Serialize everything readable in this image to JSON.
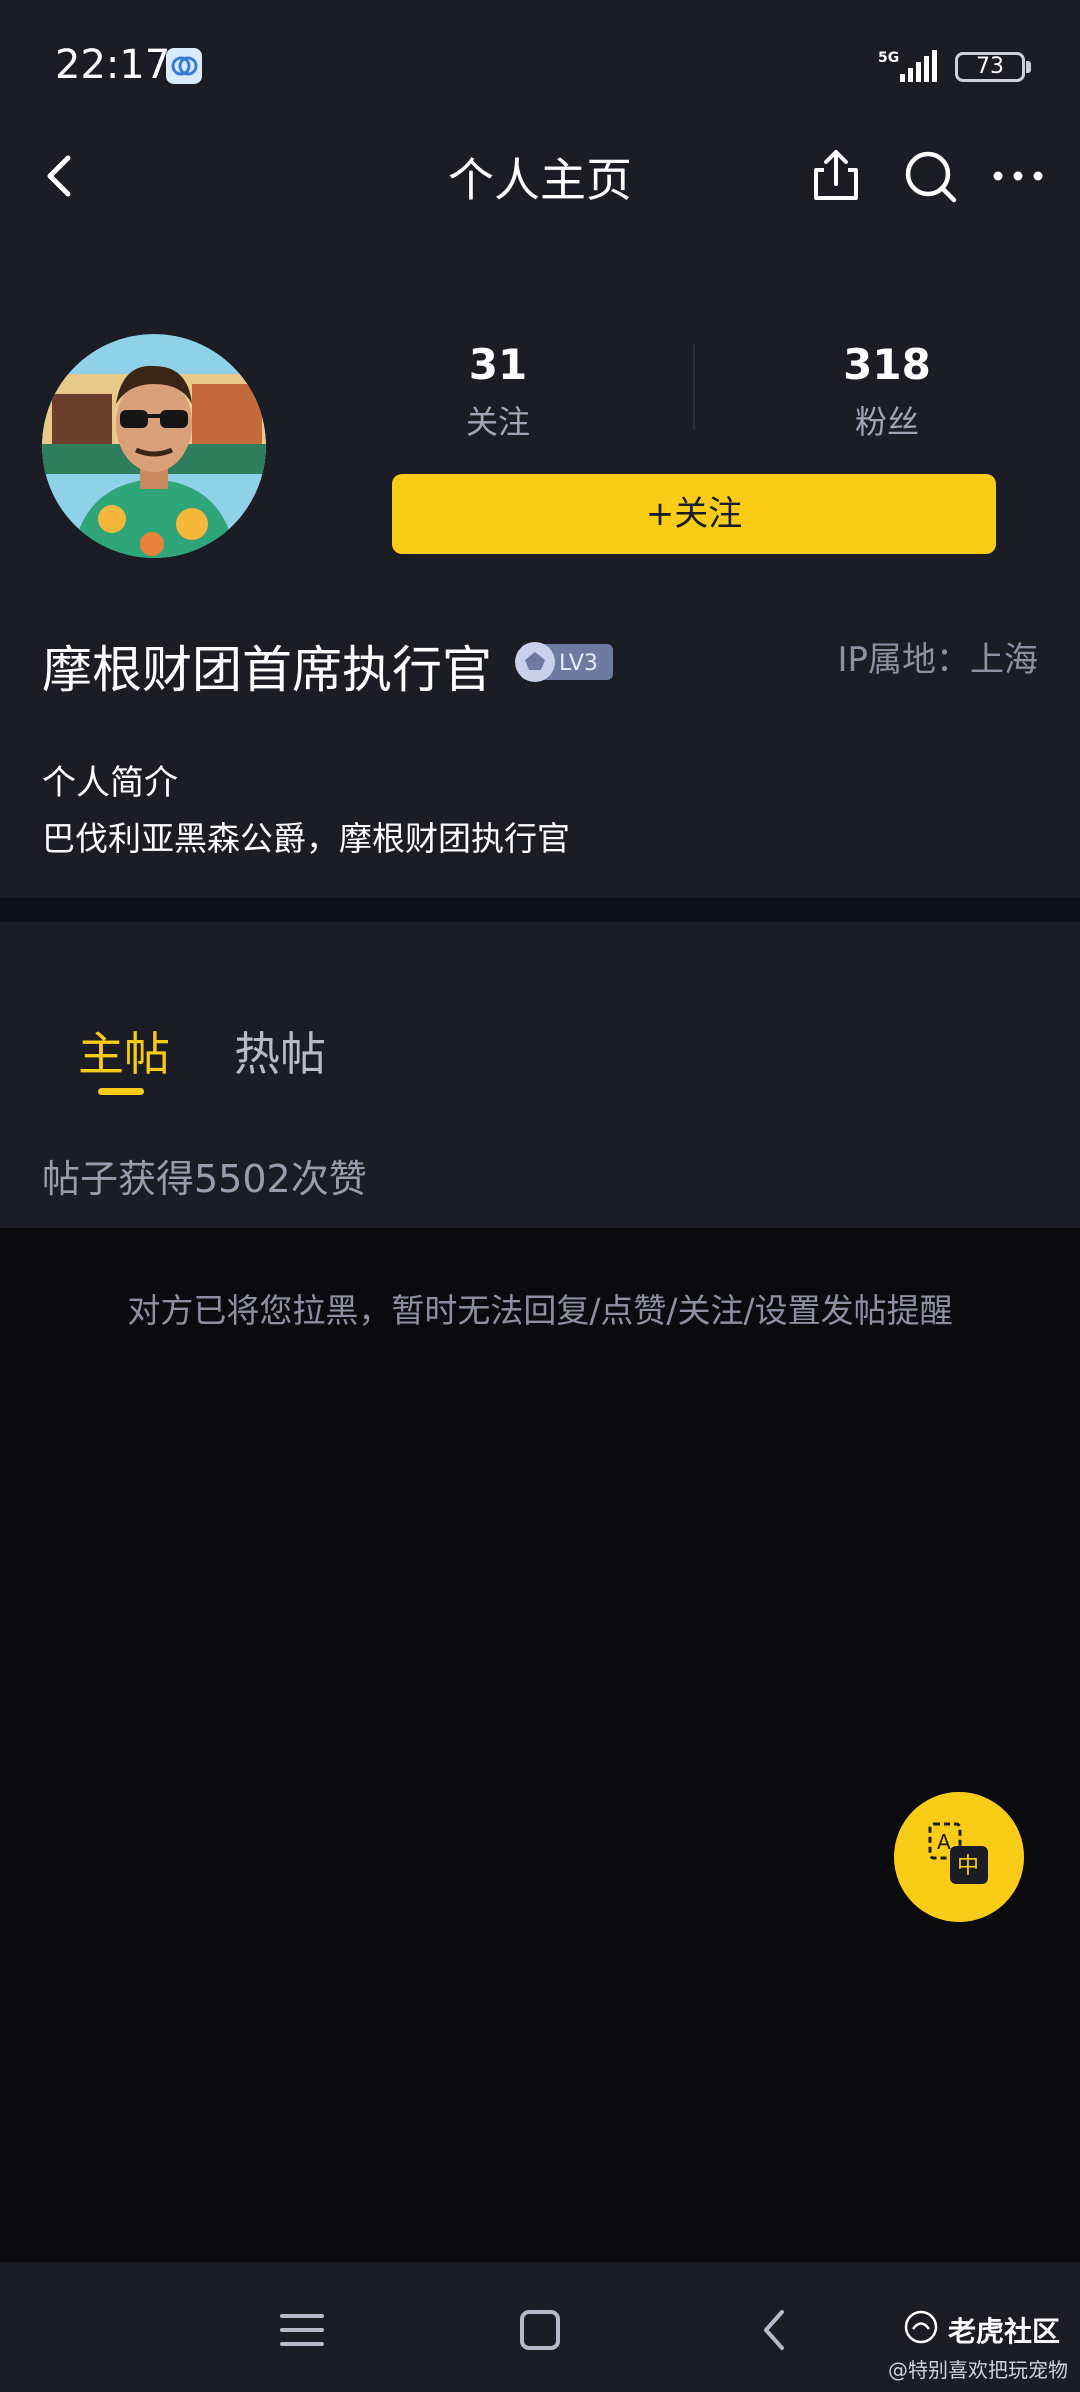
{
  "status_bar": {
    "time": "22:17",
    "network": "5G",
    "battery": "73"
  },
  "header": {
    "title": "个人主页",
    "icons": [
      "back-icon",
      "share-icon",
      "search-icon",
      "more-icon"
    ]
  },
  "profile": {
    "following_count": "31",
    "following_label": "关注",
    "followers_count": "318",
    "followers_label": "粉丝",
    "follow_button_label": "+关注",
    "username": "摩根财团首席执行官",
    "level": "LV3",
    "ip_location": "IP属地：上海",
    "bio_heading": "个人简介",
    "bio": "巴伐利亚黑森公爵，摩根财团执行官"
  },
  "tabs": [
    {
      "label": "主帖",
      "active": true
    },
    {
      "label": "热帖",
      "active": false
    }
  ],
  "posts_summary": "帖子获得5502次赞",
  "blocked_notice": "对方已将您拉黑，暂时无法回复/点赞/关注/设置发帖提醒",
  "fab": {
    "icon": "translate-icon",
    "glyph_a": "A",
    "glyph_zh": "中"
  },
  "system_nav": {
    "icons": [
      "menu-icon",
      "home-icon",
      "back-icon"
    ]
  },
  "watermark": {
    "title": "老虎社区",
    "subtitle": "@特别喜欢把玩宠物"
  },
  "colors": {
    "background": "#1b1c24",
    "content_background": "#0b0b0e",
    "accent": "#facc15",
    "muted_text": "#8e90a2"
  }
}
